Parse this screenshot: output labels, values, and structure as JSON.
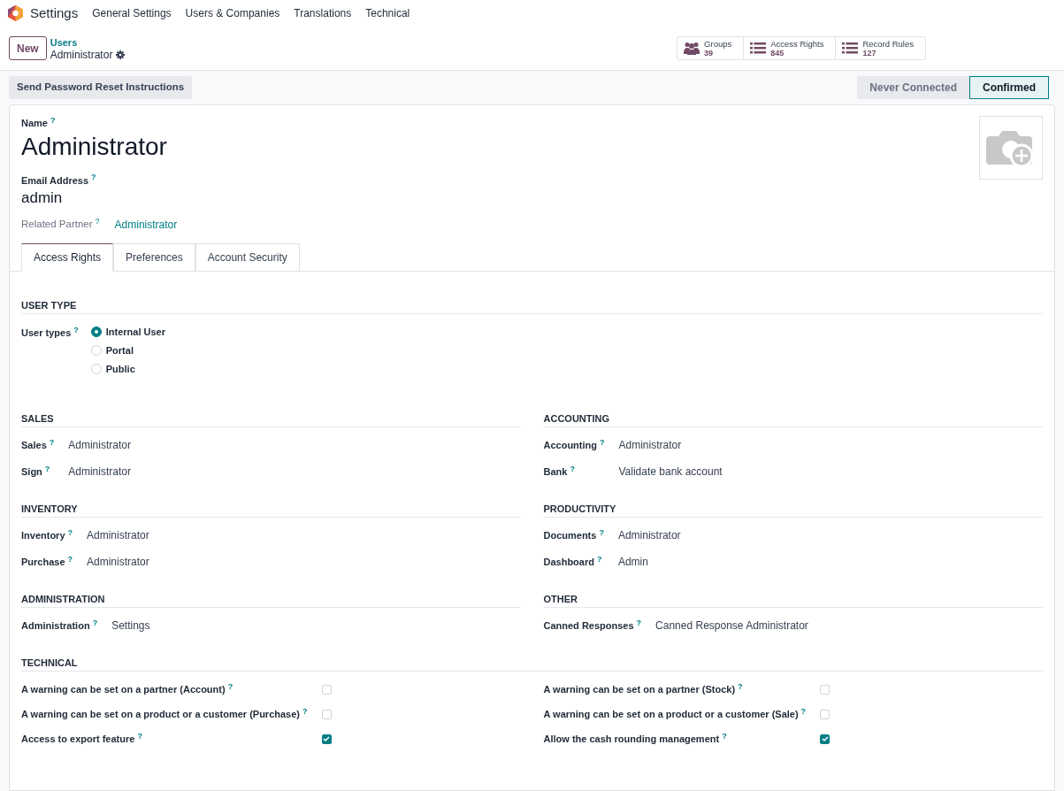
{
  "navbar": {
    "app_name": "Settings",
    "menus": [
      "General Settings",
      "Users & Companies",
      "Translations",
      "Technical"
    ]
  },
  "control_panel": {
    "new_button": "New",
    "breadcrumb": {
      "parent": "Users",
      "current": "Administrator"
    },
    "smart_buttons": [
      {
        "kind": "groups",
        "label": "Groups",
        "count": "39"
      },
      {
        "kind": "list",
        "label": "Access Rights",
        "count": "845"
      },
      {
        "kind": "list",
        "label": "Record Rules",
        "count": "127"
      }
    ]
  },
  "action_buttons": [
    "Send Password Reset Instructions"
  ],
  "status_bar": [
    {
      "label": "Never Connected",
      "selected": false
    },
    {
      "label": "Confirmed",
      "selected": true
    }
  ],
  "form": {
    "name_label": "Name",
    "name_help": "?",
    "name": "Administrator",
    "email_label": "Email Address",
    "email_help": "?",
    "email": "admin",
    "partner_label": "Related Partner",
    "partner_help": "?",
    "partner": "Administrator"
  },
  "tabs": [
    {
      "label": "Access Rights",
      "selected": true
    },
    {
      "label": "Preferences",
      "selected": false
    },
    {
      "label": "Account Security",
      "selected": false
    }
  ],
  "user_type": {
    "title": "USER TYPE",
    "label": "User types",
    "help": "?",
    "options": [
      {
        "label": "Internal User",
        "selected": true
      },
      {
        "label": "Portal",
        "selected": false
      },
      {
        "label": "Public",
        "selected": false
      }
    ]
  },
  "groups": [
    [
      {
        "title": "SALES",
        "fields": [
          {
            "label": "Sales",
            "help": "?",
            "value": "Administrator"
          },
          {
            "label": "Sign",
            "help": "?",
            "value": "Administrator"
          }
        ]
      },
      {
        "title": "ACCOUNTING",
        "fields": [
          {
            "label": "Accounting",
            "help": "?",
            "value": "Administrator"
          },
          {
            "label": "Bank",
            "help": "?",
            "value": "Validate bank account"
          }
        ]
      }
    ],
    [
      {
        "title": "INVENTORY",
        "fields": [
          {
            "label": "Inventory",
            "help": "?",
            "value": "Administrator"
          },
          {
            "label": "Purchase",
            "help": "?",
            "value": "Administrator"
          }
        ]
      },
      {
        "title": "PRODUCTIVITY",
        "fields": [
          {
            "label": "Documents",
            "help": "?",
            "value": "Administrator"
          },
          {
            "label": "Dashboard",
            "help": "?",
            "value": "Admin"
          }
        ]
      }
    ],
    [
      {
        "title": "ADMINISTRATION",
        "fields": [
          {
            "label": "Administration",
            "help": "?",
            "value": "Settings"
          }
        ]
      },
      {
        "title": "OTHER",
        "fields": [
          {
            "label": "Canned Responses",
            "help": "?",
            "value": "Canned Response Administrator"
          }
        ]
      }
    ]
  ],
  "technical": {
    "title": "TECHNICAL",
    "columns": [
      [
        {
          "label": "A warning can be set on a partner (Account)",
          "help": "?",
          "checked": false
        },
        {
          "label": "A warning can be set on a product or a customer (Purchase)",
          "help": "?",
          "checked": false
        },
        {
          "label": "Access to export feature",
          "help": "?",
          "checked": true
        }
      ],
      [
        {
          "label": "A warning can be set on a partner (Stock)",
          "help": "?",
          "checked": false
        },
        {
          "label": "A warning can be set on a product or a customer (Sale)",
          "help": "?",
          "checked": false
        },
        {
          "label": "Allow the cash rounding management",
          "help": "?",
          "checked": true
        }
      ]
    ]
  }
}
